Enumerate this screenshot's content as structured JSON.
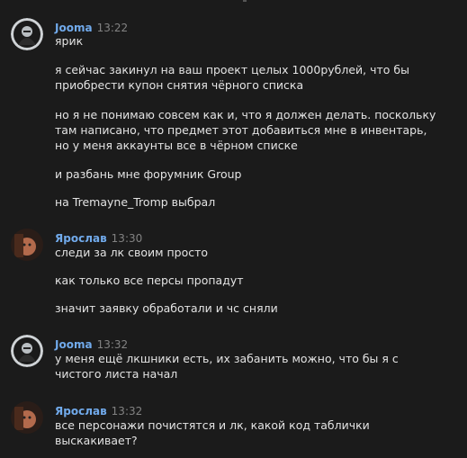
{
  "messages": [
    {
      "author": "Jooma",
      "time": "13:22",
      "avatar": "jooma-avatar",
      "lines": [
        "ярик",
        "я сейчас закинул на ваш проект целых 1000рублей, что бы\nприобрести купон снятия чёрного списка",
        "но я не понимаю совсем как и, что я должен делать. поскольку\nтам написано, что предмет этот добавиться мне в инвентарь,\nно у меня аккаунты все в чёрном списке",
        "и разбань мне форумник Group",
        "на Tremayne_Tromp выбрал"
      ]
    },
    {
      "author": "Ярослав",
      "time": "13:30",
      "avatar": "yaroslav-avatar",
      "lines": [
        "следи за лк своим просто",
        "как только все персы пропадут",
        "значит заявку обработали и чс сняли"
      ]
    },
    {
      "author": "Jooma",
      "time": "13:32",
      "avatar": "jooma-avatar",
      "lines": [
        "у меня ещё лкшники есть, их забанить можно, что бы я с\nчистого листа начал"
      ]
    },
    {
      "author": "Ярослав",
      "time": "13:32",
      "avatar": "yaroslav-avatar",
      "lines": [
        "все персонажи почистятся и лк, какой код таблички\nвыскакивает?"
      ]
    }
  ],
  "colors": {
    "background": "#1b1b1b",
    "author": "#71aaeb",
    "time": "#828282",
    "text": "#e3e3e3"
  }
}
